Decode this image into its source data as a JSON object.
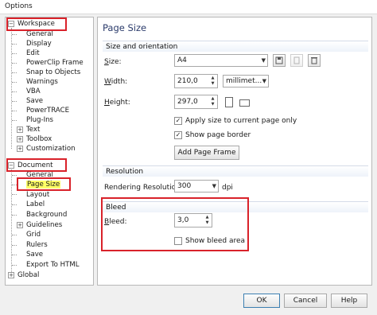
{
  "window": {
    "title": "Options"
  },
  "tree": {
    "workspace": {
      "label": "Workspace",
      "items": [
        "General",
        "Display",
        "Edit",
        "PowerClip Frame",
        "Snap to Objects",
        "Warnings",
        "VBA",
        "Save",
        "PowerTRACE",
        "Plug-Ins",
        "Text",
        "Toolbox",
        "Customization"
      ]
    },
    "document": {
      "label": "Document",
      "items": [
        "General",
        "Page Size",
        "Layout",
        "Label",
        "Background",
        "Guidelines",
        "Grid",
        "Rulers",
        "Save",
        "Export To HTML"
      ]
    },
    "global": {
      "label": "Global"
    }
  },
  "panel": {
    "title": "Page Size",
    "size_orientation": {
      "heading": "Size and orientation",
      "size_label": "Size:",
      "size_value": "A4",
      "width_label": "Width:",
      "width_value": "210,0",
      "unit_value": "millimet...",
      "height_label": "Height:",
      "height_value": "297,0",
      "apply_label": "Apply size to current page only",
      "border_label": "Show page border",
      "add_frame_label": "Add Page Frame"
    },
    "resolution": {
      "heading": "Resolution",
      "label": "Rendering Resolution:",
      "value": "300",
      "unit": "dpi"
    },
    "bleed": {
      "heading": "Bleed",
      "label": "Bleed:",
      "value": "3,0",
      "show_label": "Show bleed area"
    }
  },
  "footer": {
    "ok": "OK",
    "cancel": "Cancel",
    "help": "Help"
  },
  "colors": {
    "highlight": "#ffff66",
    "annotation": "#d9222a",
    "title": "#2b3b6b"
  }
}
